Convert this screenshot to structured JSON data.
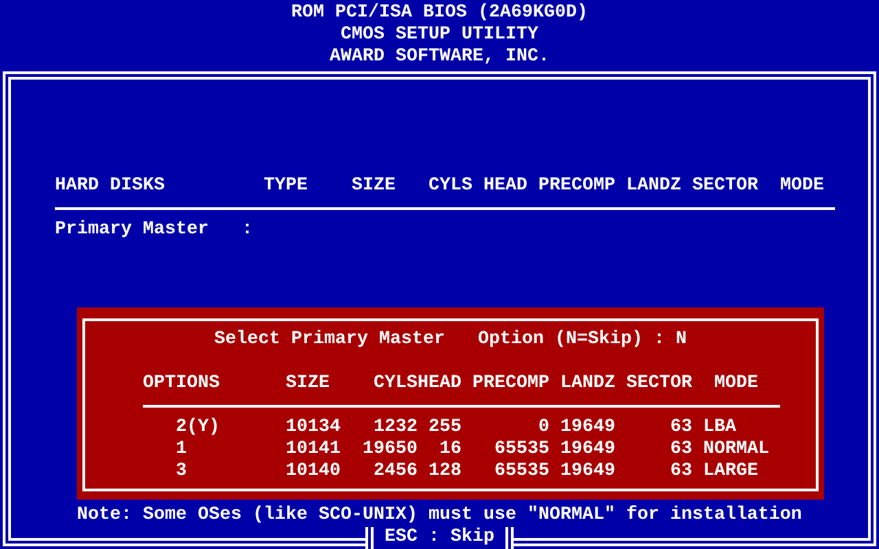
{
  "header": {
    "lines": [
      "ROM PCI/ISA BIOS (2A69KG0D)",
      "CMOS SETUP UTILITY",
      "AWARD SOFTWARE, INC."
    ]
  },
  "table": {
    "columns": [
      "HARD DISKS",
      "TYPE",
      "SIZE",
      "CYLS",
      "HEAD",
      "PRECOMP",
      "LANDZ",
      "SECTOR",
      "MODE"
    ],
    "rows": [
      {
        "name": "Primary Master",
        "separator": ":"
      }
    ]
  },
  "dialog": {
    "title": "Select Primary Master",
    "prompt": "Option (N=Skip) : N",
    "columns": [
      "OPTIONS",
      "SIZE",
      "CYLS",
      "HEAD",
      "PRECOMP",
      "LANDZ",
      "SECTOR",
      "MODE"
    ],
    "rows": [
      {
        "cells": [
          "2(Y)",
          "10134",
          "1232",
          "255",
          "0",
          "19649",
          "63",
          "LBA"
        ]
      },
      {
        "cells": [
          "1",
          "10141",
          "19650",
          "16",
          "65535",
          "19649",
          "63",
          "NORMAL"
        ]
      },
      {
        "cells": [
          "3",
          "10140",
          "2456",
          "128",
          "65535",
          "19649",
          "63",
          "LARGE"
        ]
      }
    ]
  },
  "note": "Note: Some OSes (like SCO-UNIX) must use \"NORMAL\" for installation",
  "footer_hint": "ESC : Skip"
}
